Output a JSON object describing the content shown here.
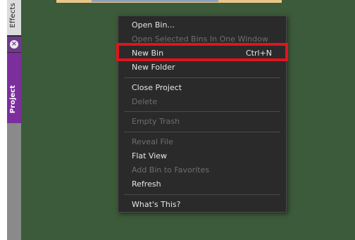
{
  "side_tabs": {
    "effects_label": "Effects",
    "close_symbol": "×",
    "project_label": "Project"
  },
  "context_menu": {
    "items": [
      {
        "label": "Open Bin...",
        "shortcut": "",
        "enabled": true
      },
      {
        "label": "Open Selected Bins In One Window",
        "shortcut": "",
        "enabled": false
      },
      {
        "label": "New Bin",
        "shortcut": "Ctrl+N",
        "enabled": true,
        "highlighted": true
      },
      {
        "label": "New Folder",
        "shortcut": "",
        "enabled": true
      },
      {
        "label": "Close Project",
        "shortcut": "",
        "enabled": true
      },
      {
        "label": "Delete",
        "shortcut": "",
        "enabled": false
      },
      {
        "label": "Empty Trash",
        "shortcut": "",
        "enabled": false
      },
      {
        "label": "Reveal File",
        "shortcut": "",
        "enabled": false
      },
      {
        "label": "Flat View",
        "shortcut": "",
        "enabled": true
      },
      {
        "label": "Add Bin to Favorites",
        "shortcut": "",
        "enabled": false
      },
      {
        "label": "Refresh",
        "shortcut": "",
        "enabled": true
      },
      {
        "label": "What's This?",
        "shortcut": "",
        "enabled": true
      }
    ]
  },
  "colors": {
    "panel_background": "#3c5b3a",
    "menu_background": "#2a2a2a",
    "highlight_border": "#e0141e",
    "project_tab": "#7b2f9c"
  }
}
